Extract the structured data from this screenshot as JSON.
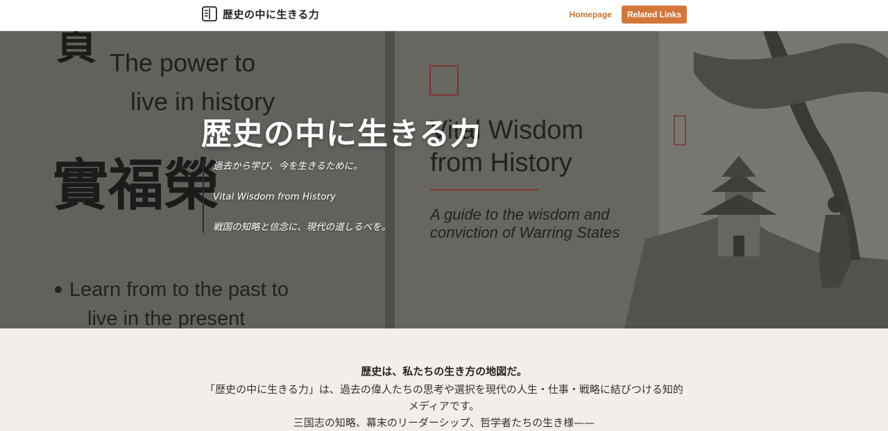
{
  "header": {
    "brand_icon": "book-icon",
    "brand_title": "歴史の中に生きる力",
    "nav": {
      "homepage": "Homepage",
      "related_links": "Related Links"
    }
  },
  "hero": {
    "title": "歴史の中に生きる力",
    "lines": [
      "過去から学び、今を生きるために。",
      "Vital Wisdom from History",
      "戦国の知略と信念に、現代の道しるべを。"
    ],
    "image": {
      "left_heading": "The power to live in history",
      "left_calligraphy": "貞 實 福 榮",
      "left_bullet": "Learn from to the past to live in the present",
      "book_title": "Vital Wisdom from History",
      "book_subtitle": "A guide to the wisdom and conviction of Warring States"
    }
  },
  "intro": {
    "heading": "歴史は、私たちの生き方の地図だ。",
    "paragraph": "「歴史の中に生きる力」は、過去の偉人たちの思考や選択を現代の人生・仕事・戦略に結びつける知的メディアです。",
    "paragraph2": "三国志の知略、幕末のリーダーシップ、哲学者たちの生き様——"
  },
  "colors": {
    "accent": "#d3773a",
    "link": "#c9702e",
    "section_bg": "#f3eee9"
  }
}
